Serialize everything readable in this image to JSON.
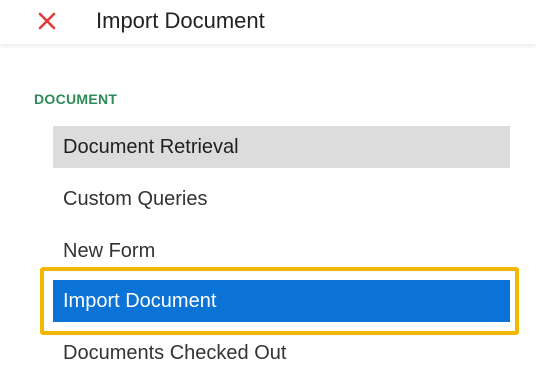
{
  "header": {
    "close_icon": "close-x-icon",
    "close_color": "#e53935",
    "title": "Import Document"
  },
  "section": {
    "label": "DOCUMENT",
    "label_color": "#2e8b57"
  },
  "menu": {
    "items": [
      {
        "label": "Document Retrieval",
        "state": "hover"
      },
      {
        "label": "Custom Queries",
        "state": "normal"
      },
      {
        "label": "New Form",
        "state": "normal"
      },
      {
        "label": "Import Document",
        "state": "selected"
      },
      {
        "label": "Documents Checked Out",
        "state": "normal"
      }
    ],
    "selected_color": "#0b73d6",
    "hover_color": "#dcdcdc",
    "focus_ring_color": "#f5b800"
  }
}
